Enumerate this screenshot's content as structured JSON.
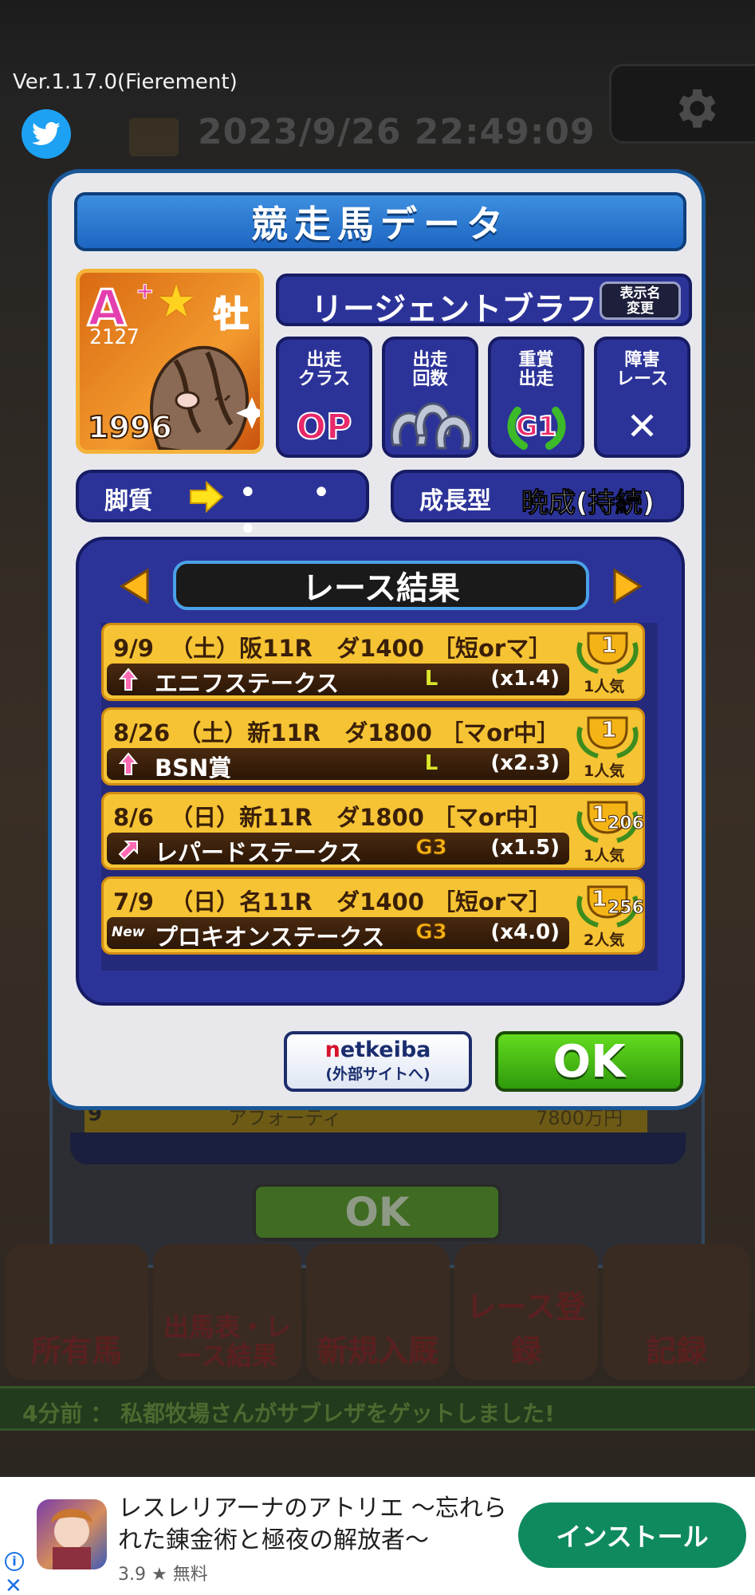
{
  "app": {
    "version": "Ver.1.17.0(Fierement)",
    "datetime": "2023/9/26  22:49:09"
  },
  "background": {
    "ok_label": "OK",
    "list_row": {
      "num": "9",
      "name": "アフォーティ",
      "prize": "7800万円"
    },
    "menu": [
      "所有馬",
      "出馬表・レース結果",
      "新規入厩",
      "レース登録",
      "記録"
    ],
    "ticker": "4分前 ： 私都牧場さんがサブレザをゲットしました!"
  },
  "modal": {
    "title": "競走馬データ",
    "horse": {
      "rank": "A",
      "rank_plus": "+",
      "sex": "牡",
      "rating": "2127",
      "year": "1996",
      "name": "リージェントブラフ",
      "rename_label": "表示名\n変更"
    },
    "stats": [
      {
        "label": "出走\nクラス",
        "value": "OP",
        "icon": "op-badge"
      },
      {
        "label": "出走\n回数",
        "value": "",
        "icon": "horseshoes-icon"
      },
      {
        "label": "重賞\n出走",
        "value": "G1",
        "icon": "g1-laurel-icon"
      },
      {
        "label": "障害\nレース",
        "value": "✕",
        "icon": "cross-icon"
      }
    ],
    "running_style": {
      "label": "脚質",
      "dots": "• • •"
    },
    "growth": {
      "label": "成長型",
      "value": "晩成(持続)"
    },
    "results": {
      "title": "レース結果",
      "rows": [
        {
          "date": "9/9",
          "day": "（土）",
          "place": "阪11R",
          "course": "ダ1400",
          "cond": "［短orマ］",
          "name": "エニフステークス",
          "grade": "L",
          "odds": "(x1.4)",
          "icon": "arrow-up-icon",
          "place_num": "1",
          "field": "",
          "popularity": "1人気"
        },
        {
          "date": "8/26",
          "day": "（土）",
          "place": "新11R",
          "course": "ダ1800",
          "cond": "［マor中］",
          "name": "BSN賞",
          "grade": "L",
          "odds": "(x2.3)",
          "icon": "arrow-up-icon",
          "place_num": "1",
          "field": "",
          "popularity": "1人気"
        },
        {
          "date": "8/6",
          "day": "（日）",
          "place": "新11R",
          "course": "ダ1800",
          "cond": "［マor中］",
          "name": "レパードステークス",
          "grade": "G3",
          "odds": "(x1.5)",
          "icon": "arrow-up-right-icon",
          "place_num": "1",
          "field": "206",
          "popularity": "1人気"
        },
        {
          "date": "7/9",
          "day": "（日）",
          "place": "名11R",
          "course": "ダ1400",
          "cond": "［短orマ］",
          "name": "プロキオンステークス",
          "grade": "G3",
          "odds": "(x4.0)",
          "icon": "new-badge",
          "new_label": "New",
          "place_num": "1",
          "field": "256",
          "popularity": "2人気"
        }
      ]
    },
    "buttons": {
      "netkeiba_brand_n": "n",
      "netkeiba_brand_rest": "etkeiba",
      "netkeiba_sub": "(外部サイトへ)",
      "ok": "OK"
    }
  },
  "ad": {
    "title": "レスレリアーナのアトリエ ～忘れられた錬金術と極夜の解放者～",
    "rating": "3.9",
    "star": "★",
    "price": "無料",
    "install_label": "インストール"
  },
  "colors": {
    "modal_border": "#1a5797",
    "panel_blue": "#2c3398",
    "result_row": "#f6c334",
    "ok_green": "#3fb414",
    "ad_install": "#0f8a5f"
  }
}
